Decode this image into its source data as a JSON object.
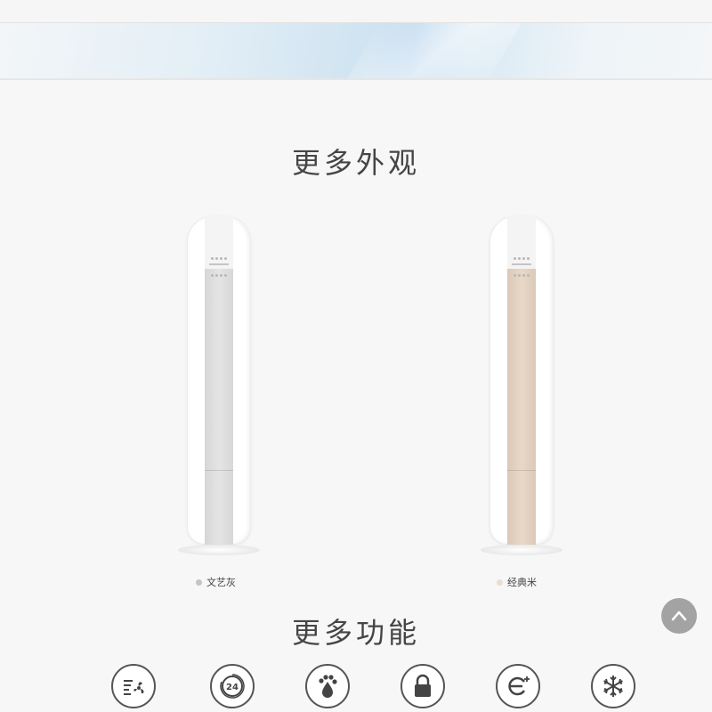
{
  "sections": {
    "appearance_title": "更多外观",
    "functions_title": "更多功能"
  },
  "variants": [
    {
      "name": "文艺灰",
      "dot_color": "#c4c4c4",
      "panel_color": "#dcdcdc"
    },
    {
      "name": "经典米",
      "dot_color": "#e8ddd2",
      "panel_color": "#e3d2c1"
    }
  ],
  "features": [
    {
      "icon": "fan-wind-icon"
    },
    {
      "icon": "24-hour-timer-icon",
      "text": "24"
    },
    {
      "icon": "paw-water-drop-icon"
    },
    {
      "icon": "lock-icon"
    },
    {
      "icon": "e-plus-energy-icon"
    },
    {
      "icon": "snowflake-icon"
    }
  ],
  "back_to_top": {
    "icon": "chevron-up-icon"
  }
}
